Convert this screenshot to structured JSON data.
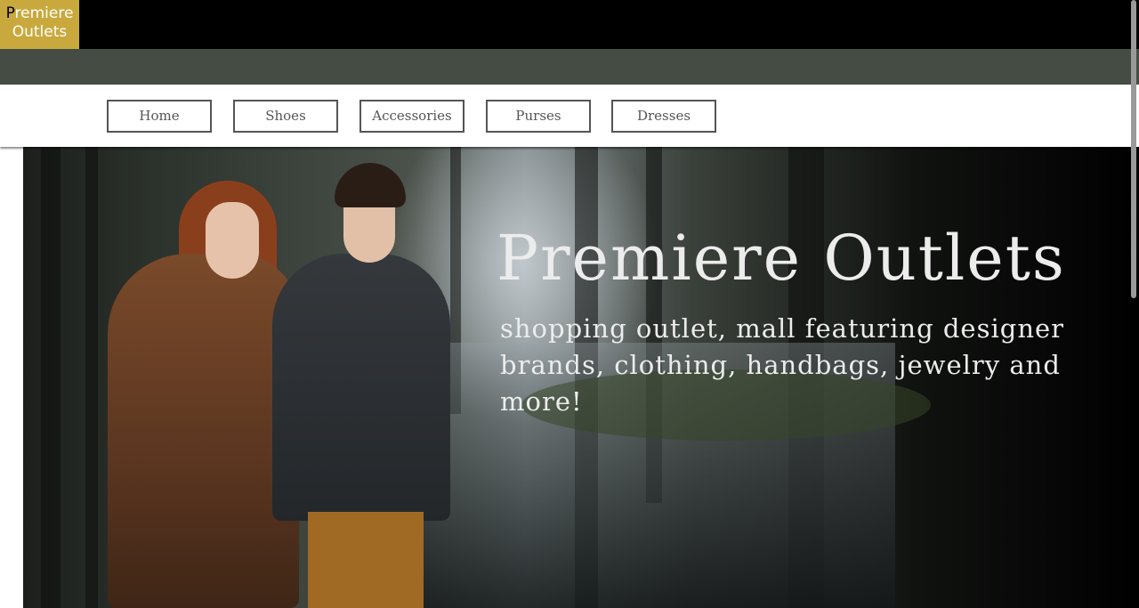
{
  "logo": {
    "first_letter": "P",
    "line1_rest": "remiere",
    "line2": "Outlets"
  },
  "nav": {
    "items": [
      {
        "label": "Home"
      },
      {
        "label": "Shoes"
      },
      {
        "label": "Accessories"
      },
      {
        "label": "Purses"
      },
      {
        "label": "Dresses"
      }
    ]
  },
  "hero": {
    "title": "Premiere Outlets",
    "subtitle": "shopping outlet, mall featuring designer brands, clothing, handbags, jewelry and more!"
  },
  "colors": {
    "topbar": "#000000",
    "logo_bg": "#c9a93e",
    "secondary_bar": "#444c44",
    "nav_border": "#555555",
    "hero_text": "#ececec"
  }
}
